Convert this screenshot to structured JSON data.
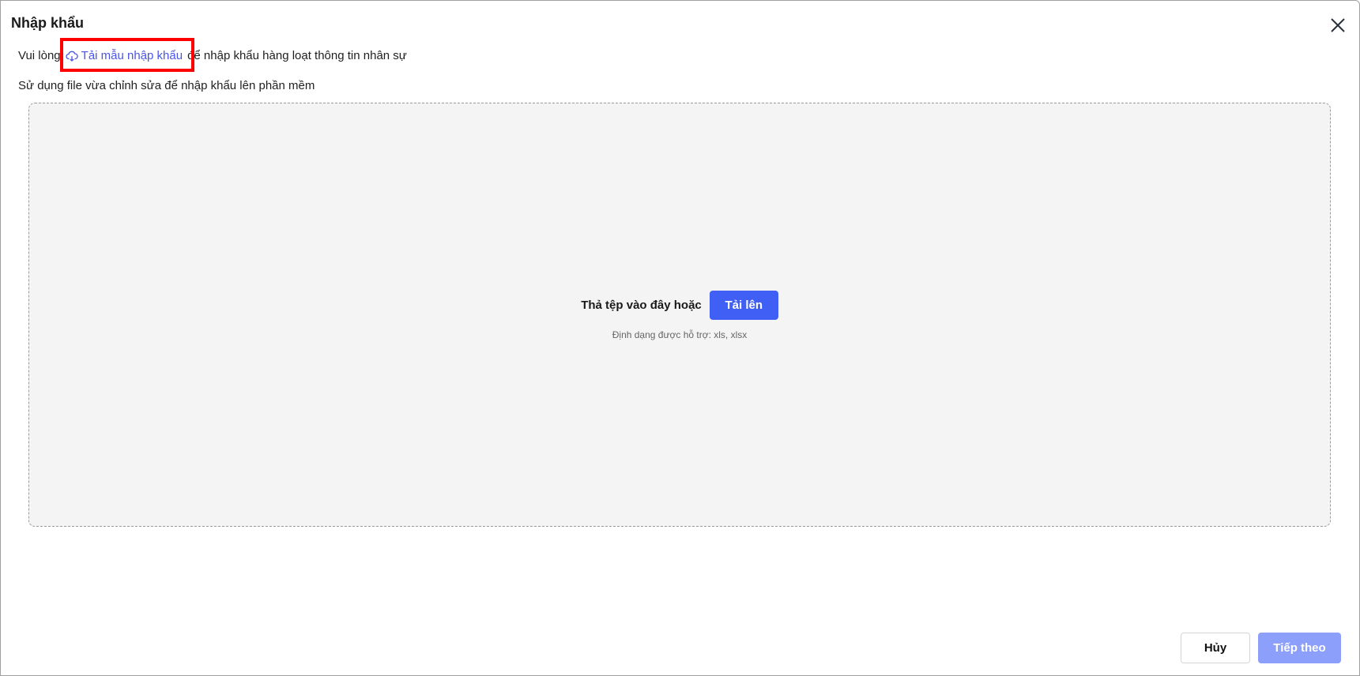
{
  "dialog": {
    "title": "Nhập khẩu",
    "close_icon": "close-icon",
    "instruction_prefix": "Vui lòng",
    "download_template_link": "Tải mẫu nhập khẩu",
    "download_icon": "cloud-download-icon",
    "instruction_suffix": "để nhập khẩu hàng loạt thông tin nhân sự",
    "instruction_line2": "Sử dụng file vừa chỉnh sửa để nhập khẩu lên phần mềm"
  },
  "dropzone": {
    "text": "Thả tệp vào đây hoặc",
    "upload_button": "Tải lên",
    "supported_formats": "Định dạng được hỗ trợ: xls, xlsx"
  },
  "footer": {
    "cancel_button": "Hủy",
    "next_button": "Tiếp theo"
  },
  "colors": {
    "accent": "#4060f5",
    "link": "#4a55e8",
    "disabled_primary": "#8c9ffa",
    "highlight": "#ff0000"
  }
}
